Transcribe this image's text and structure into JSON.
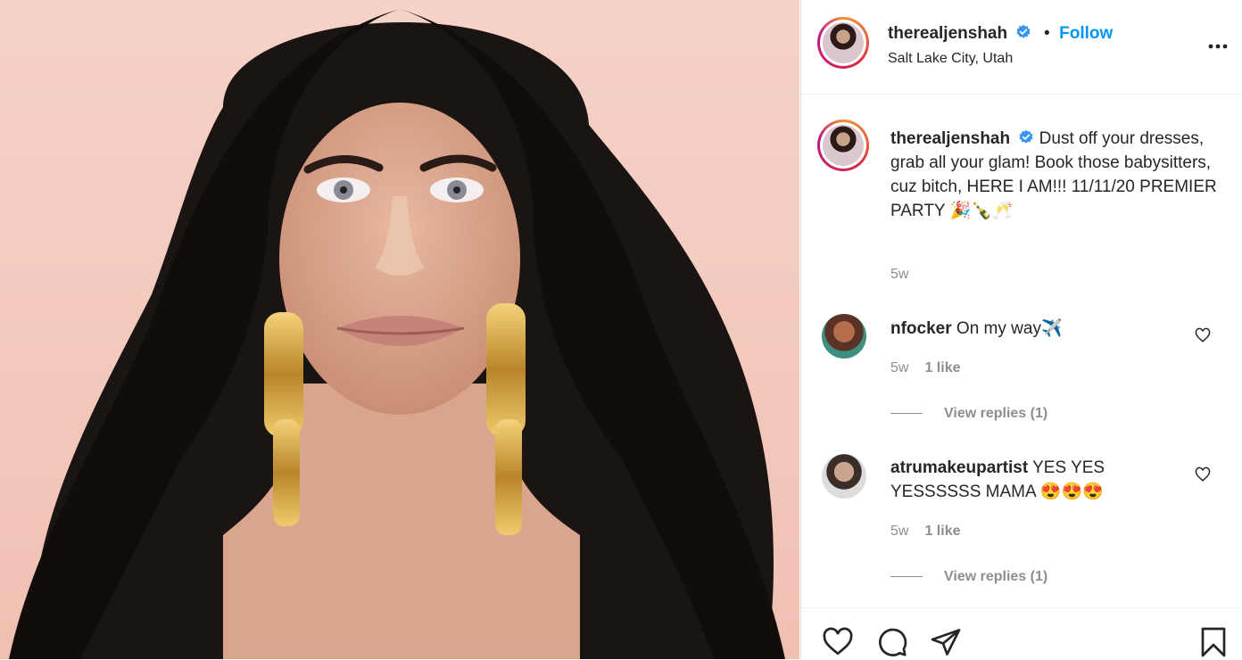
{
  "post": {
    "username": "therealjenshah",
    "follow_label": "Follow",
    "location": "Salt Lake City, Utah",
    "caption_text": "Dust off your dresses, grab all your glam! Book those babysitters, cuz bitch, HERE I AM!!! 11/11/20 PREMIER PARTY 🎉🍾🥂",
    "time_ago": "5w"
  },
  "comments": [
    {
      "username": "nfocker",
      "text": "On my way✈️",
      "time": "5w",
      "likes": "1 like",
      "replies": "View replies (1)"
    },
    {
      "username": "atrumakeupartist",
      "text": "YES YES YESSSSSS MAMA 😍😍😍",
      "time": "5w",
      "likes": "1 like",
      "replies": "View replies (1)"
    }
  ],
  "icons": {
    "like": "heart-icon",
    "comment": "comment-icon",
    "share": "paper-plane-icon",
    "save": "bookmark-icon",
    "more": "more-options-icon",
    "verified": "verified-badge-icon"
  },
  "colors": {
    "accent": "#0095f6",
    "verified": "#3897f0",
    "muted": "#8e8e8e"
  }
}
